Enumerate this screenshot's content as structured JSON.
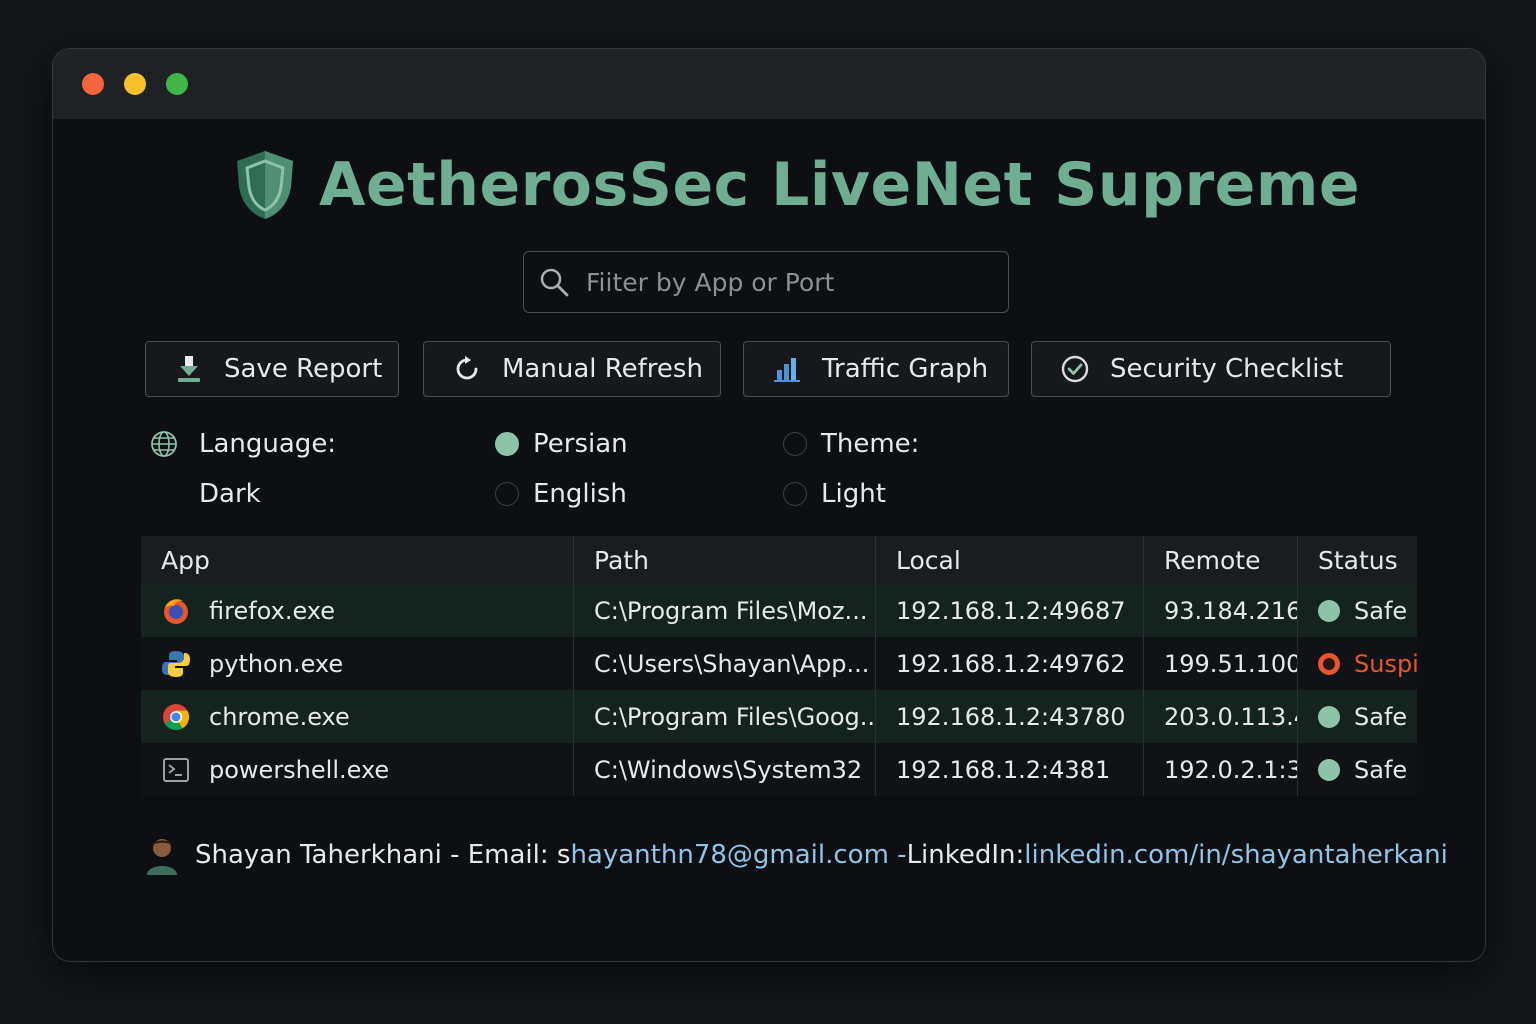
{
  "window": {
    "title": "AetherosSec LiveNet Supreme",
    "traffic_lights": [
      "close",
      "minimize",
      "maximize"
    ]
  },
  "search": {
    "placeholder": "Fiiter by App or Port",
    "value": ""
  },
  "toolbar": {
    "save_label": "Save Report",
    "refresh_label": "Manual Refresh",
    "graph_label": "Traffic Graph",
    "checklist_label": "Security Checklist"
  },
  "options": {
    "language_label": "Language:",
    "dark_label": "Dark",
    "persian_label": "Persian",
    "english_label": "English",
    "theme_label": "Theme:",
    "light_label": "Light",
    "selected_language": "Persian"
  },
  "table": {
    "headers": [
      "App",
      "Path",
      "Local",
      "Remote",
      "Status"
    ],
    "rows": [
      {
        "icon": "firefox-icon",
        "app": "firefox.exe",
        "path": "C:\\Program Files\\Moz...",
        "local": "192.168.1.2:49687",
        "remote": "93.184.216.",
        "status": "Safe"
      },
      {
        "icon": "python-icon",
        "app": "python.exe",
        "path": "C:\\Users\\Shayan\\App...",
        "local": "192.168.1.2:49762",
        "remote": "199.51.100:",
        "status": "Suspi"
      },
      {
        "icon": "chrome-icon",
        "app": "chrome.exe",
        "path": "C:\\Program Files\\Goog...",
        "local": "192.168.1.2:43780",
        "remote": "203.0.113.4",
        "status": "Safe"
      },
      {
        "icon": "powershell-icon",
        "app": "powershell.exe",
        "path": "C:\\Windows\\System32",
        "local": "192.168.1.2:4381",
        "remote": "192.0.2.1:3:",
        "status": "Safe"
      }
    ]
  },
  "footer": {
    "author": "Shayan Taherkhani - Email: s",
    "email": "hayanthn78@gmail.com - ",
    "linkedin_label": "LinkedIn: ",
    "linkedin_url": "linkedin.com/in/shayantaherkani"
  },
  "colors": {
    "accent": "#6fae93",
    "safe": "#8ec3aa",
    "suspicious": "#e8552e",
    "link": "#8fc4e6"
  }
}
